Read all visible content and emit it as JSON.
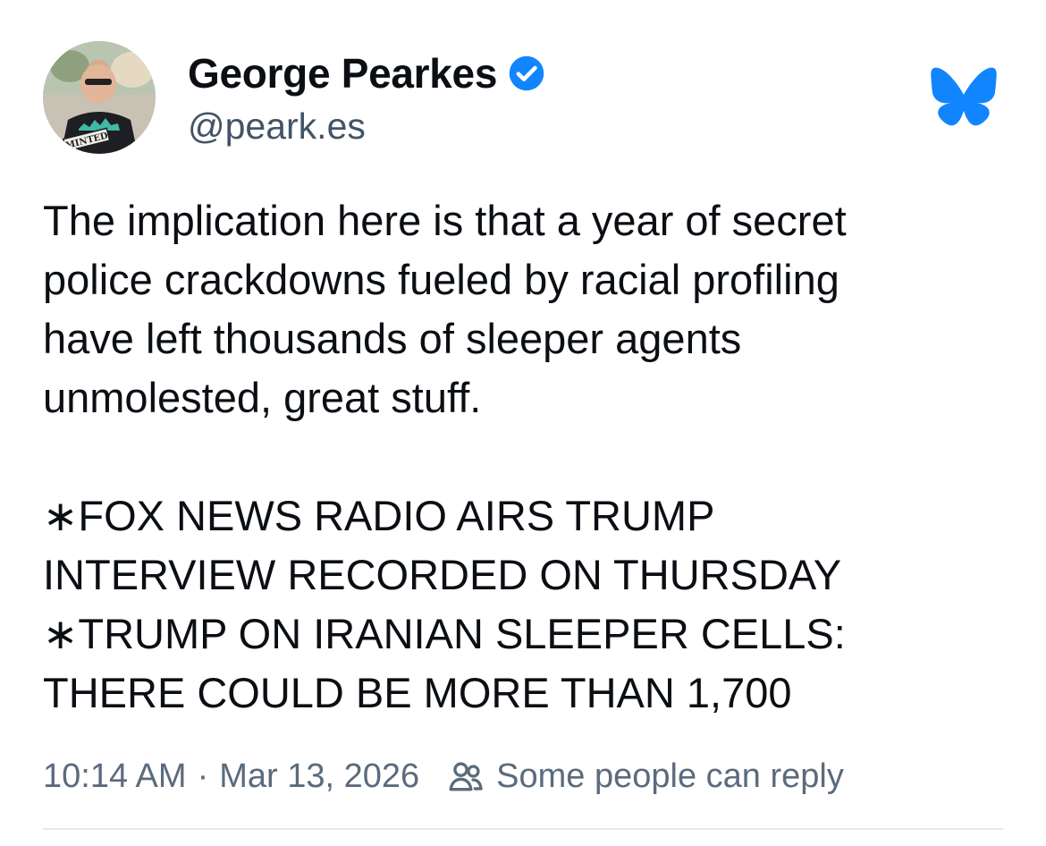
{
  "author": {
    "display_name": "George Pearkes",
    "handle": "@peark.es",
    "verified": true,
    "avatar_shirt_text": "MINTED"
  },
  "post": {
    "paragraph_1": "The implication here is that a year of secret\npolice crackdowns fueled by racial profiling\nhave left thousands of sleeper agents\nunmolested, great stuff.",
    "paragraph_2": "∗FOX NEWS RADIO AIRS TRUMP\nINTERVIEW RECORDED ON THURSDAY\n∗TRUMP ON IRANIAN SLEEPER CELLS:\nTHERE COULD BE MORE THAN 1,700"
  },
  "meta": {
    "time": "10:14 AM",
    "separator": "·",
    "date": "Mar 13, 2026",
    "reply_setting": "Some people can reply"
  },
  "icons": {
    "verified": "verified-check-icon",
    "app_logo": "bluesky-butterfly-icon",
    "reply_setting": "people-icon"
  },
  "colors": {
    "brand_blue": "#1185fe",
    "text": "#0b0f14",
    "muted": "#5b6b7d"
  }
}
